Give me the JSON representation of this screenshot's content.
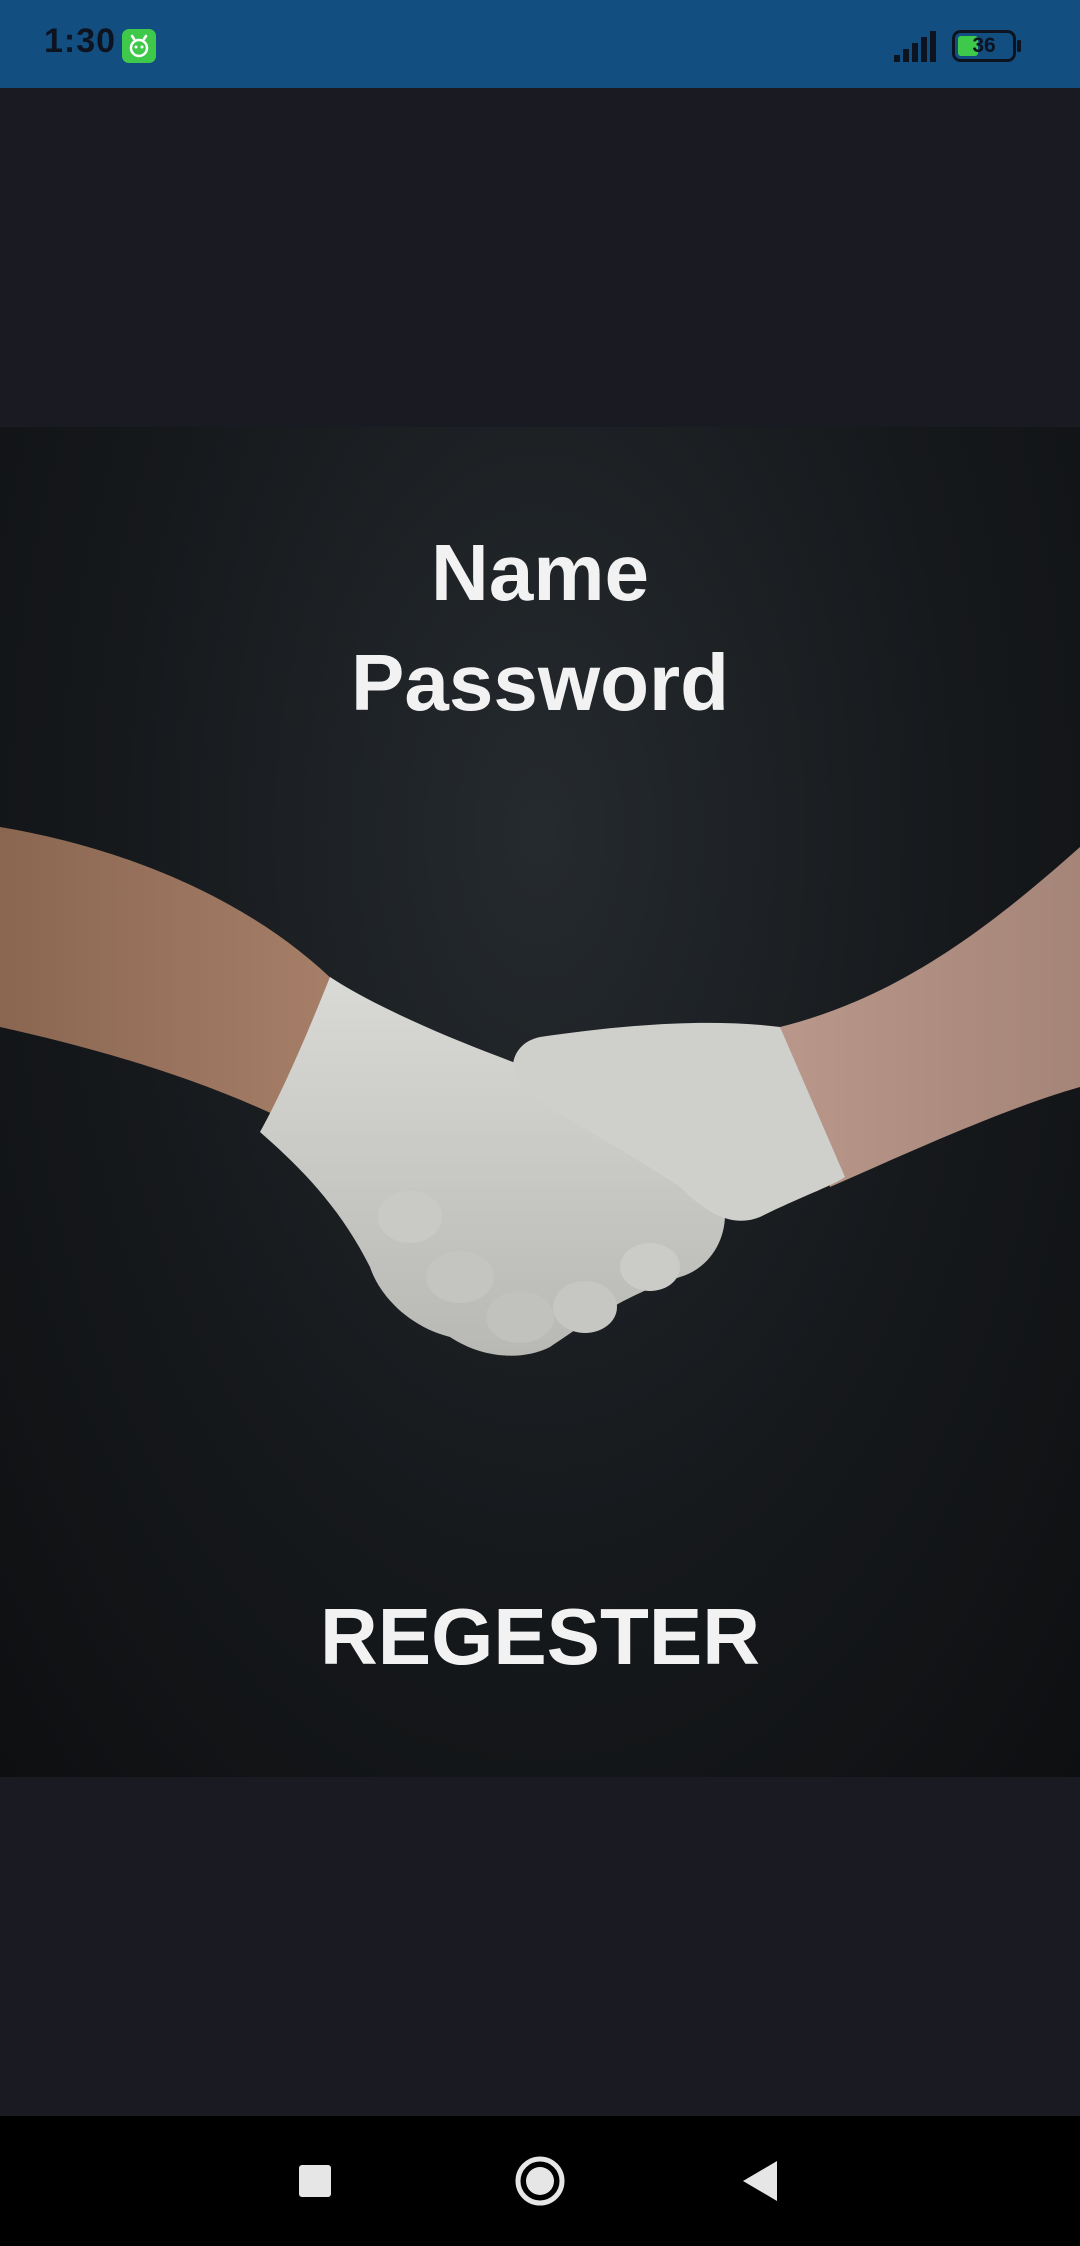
{
  "status_bar": {
    "time": "1:30",
    "battery_level": "36",
    "icons": [
      "app-notification-icon",
      "cellular-signal-icon",
      "battery-icon"
    ]
  },
  "form": {
    "name_label": "Name",
    "password_label": "Password",
    "register_label": "REGESTER"
  },
  "navigation": {
    "icons": [
      "recents-square-icon",
      "home-circle-icon",
      "back-triangle-icon"
    ]
  },
  "colors": {
    "status_bar": "#124f80",
    "page_background": "#1a1a23",
    "text": "#f2f2f2",
    "nav_bar": "#000000",
    "app_icon": "#3fc94b"
  }
}
